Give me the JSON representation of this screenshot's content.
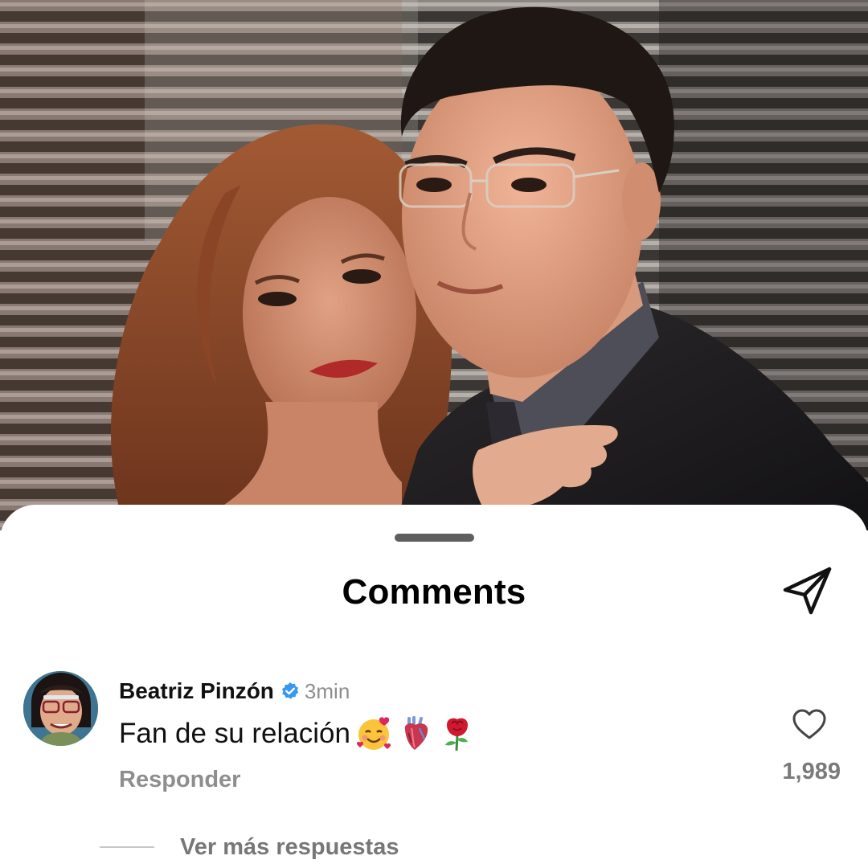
{
  "post": {
    "image_alt": "Fotografía de una pareja abrazada frente a una persiana"
  },
  "sheet": {
    "title": "Comments",
    "share_icon": "paper-plane-icon"
  },
  "comment": {
    "username": "Beatriz Pinzón",
    "verified": true,
    "timestamp": "3min",
    "text": "Fan de su relación",
    "emojis": [
      "smiling-face-with-hearts-emoji",
      "anatomical-heart-emoji",
      "rose-emoji"
    ],
    "reply_label": "Responder",
    "like_count": "1,989",
    "like_icon": "heart-outline-icon"
  },
  "replies": {
    "view_more_label": "Ver más respuestas"
  },
  "colors": {
    "text_primary": "#111111",
    "text_secondary": "#8e8e8e",
    "verified_blue": "#3897f0",
    "sheet_background": "#ffffff"
  }
}
